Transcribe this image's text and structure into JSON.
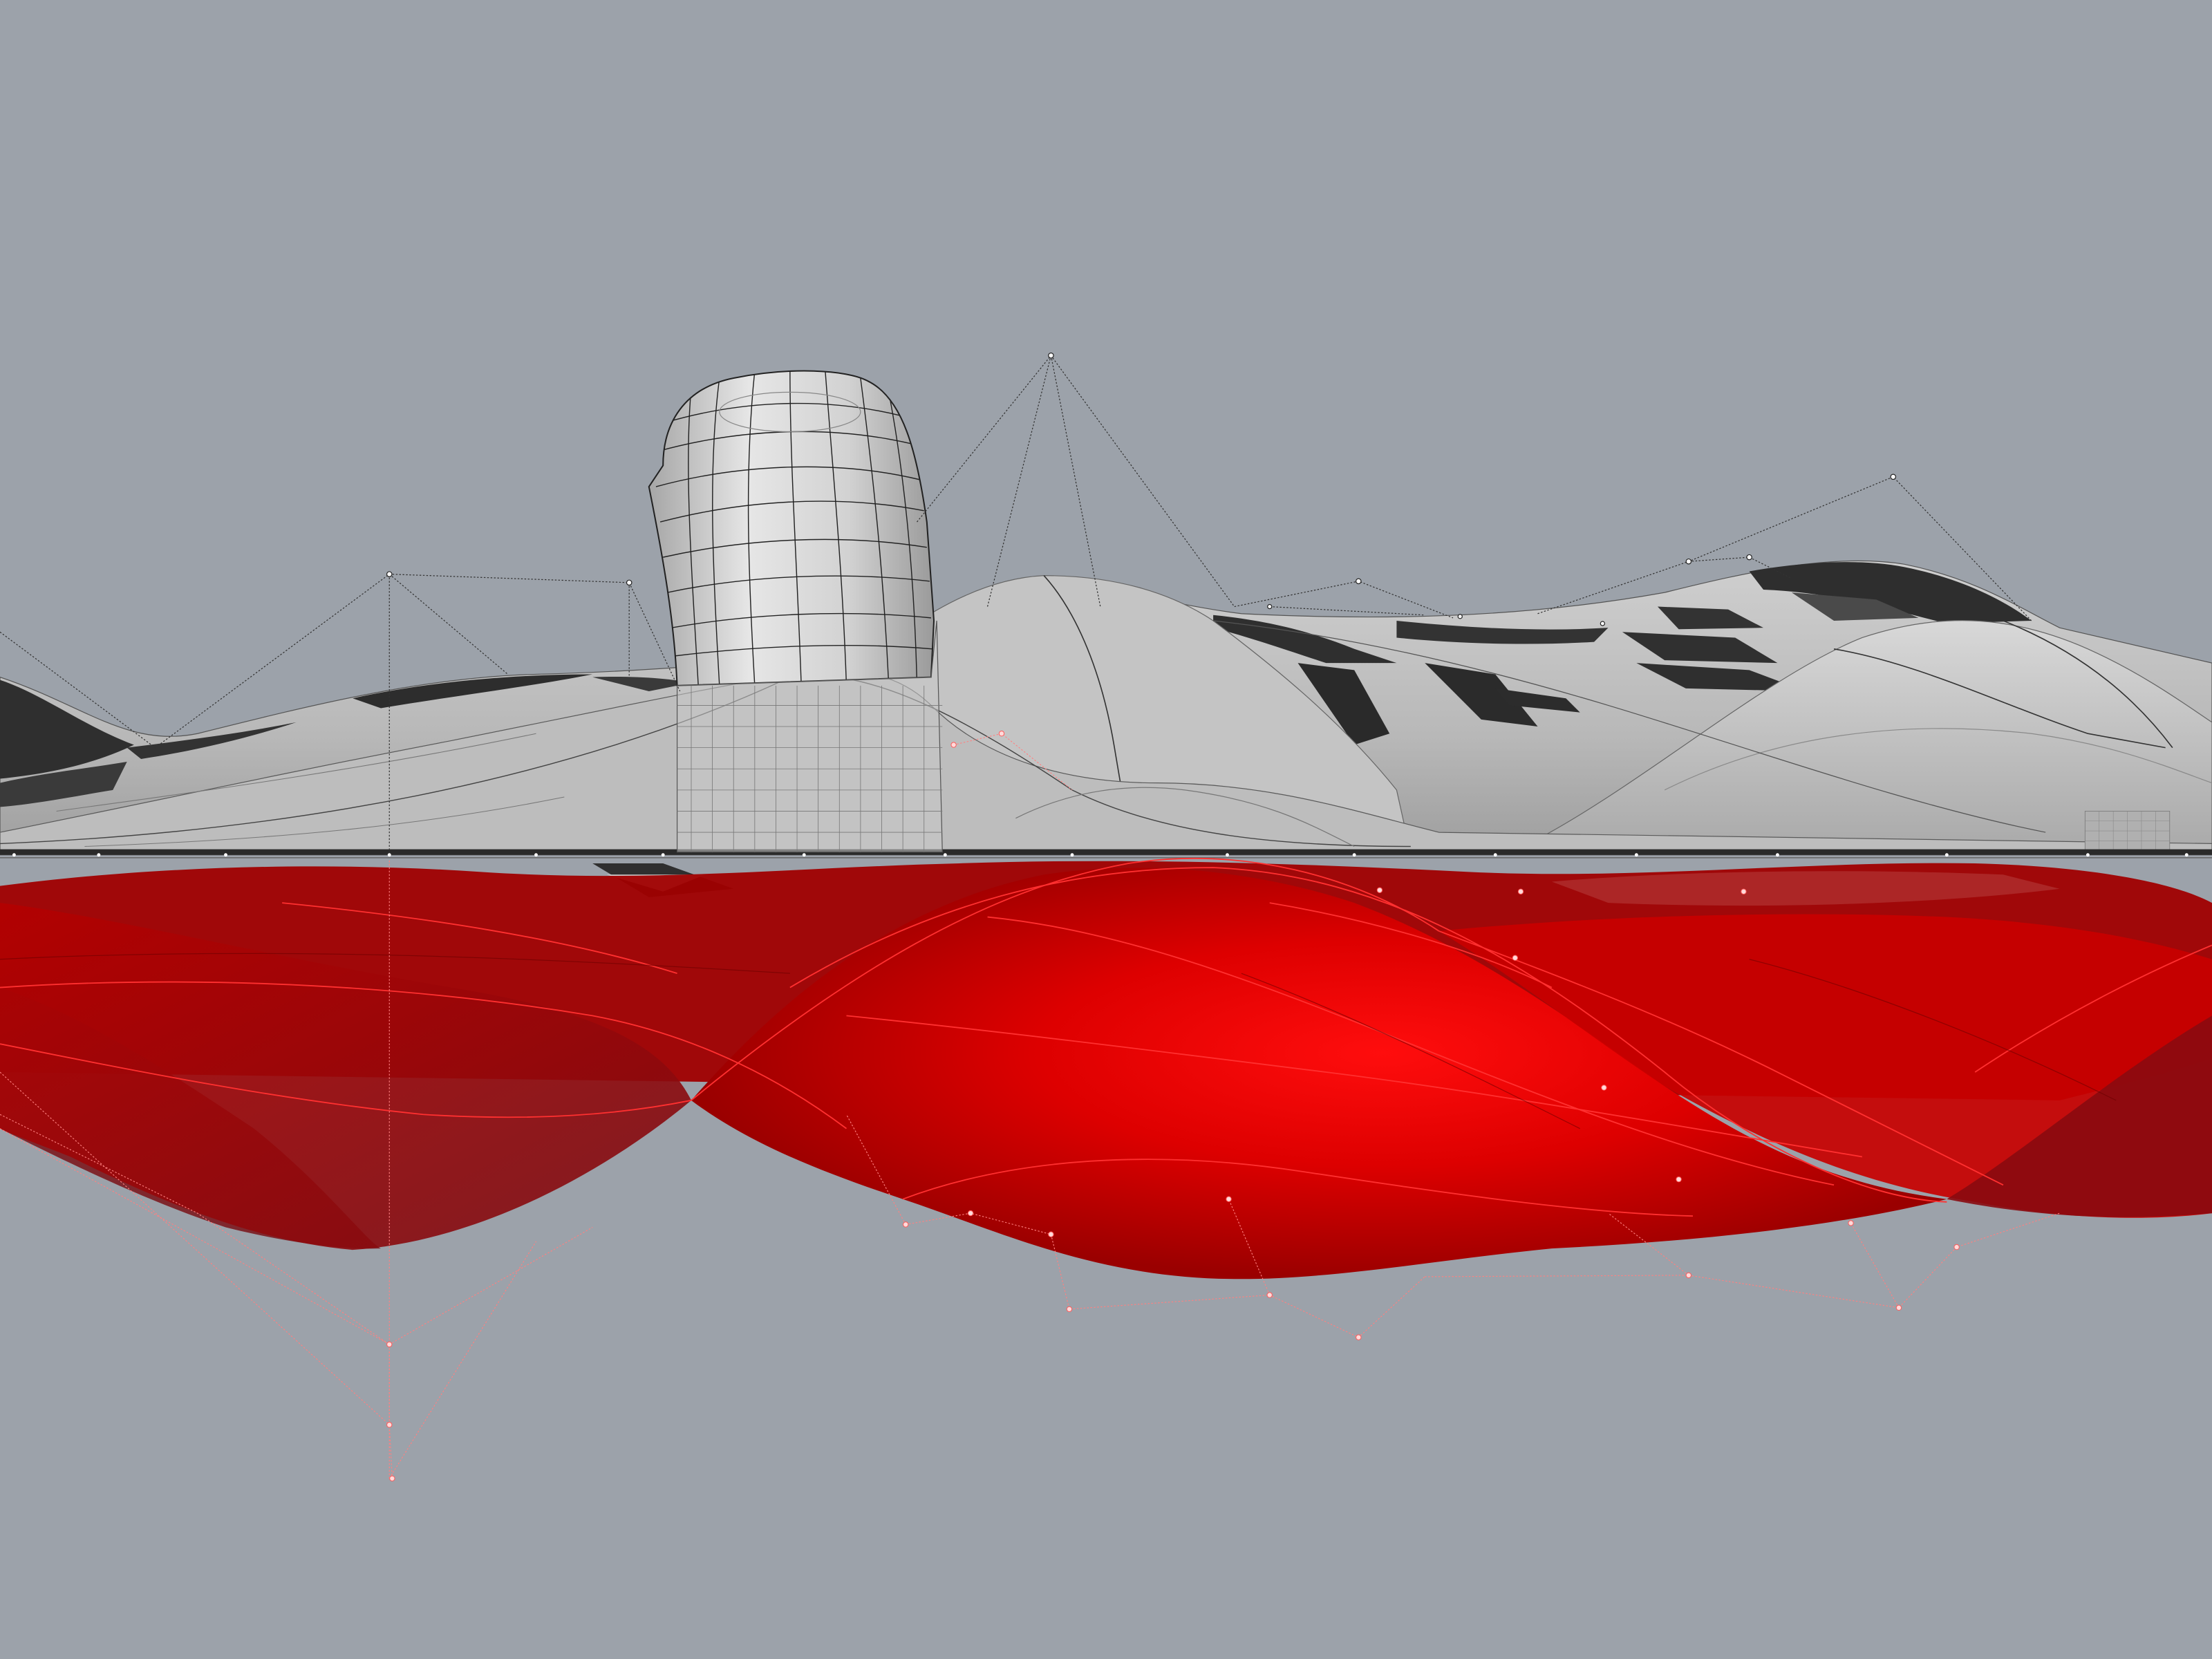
{
  "viewport": {
    "background_color": "#9ca2aa",
    "display_mode": "shaded-with-control-points"
  },
  "scene": {
    "upper_surface": {
      "color": "#b5b5b5",
      "shadow_color": "#3a3a3a",
      "state": "unselected"
    },
    "lower_surface": {
      "color": "#d60000",
      "state": "selected"
    },
    "pipe_object": {
      "color": "#cfcfcf",
      "display": "wireframe-isocurves"
    },
    "control_points": {
      "color_upper": "#2a2a2a",
      "color_lower": "#ff6a6a",
      "visible": true
    }
  }
}
